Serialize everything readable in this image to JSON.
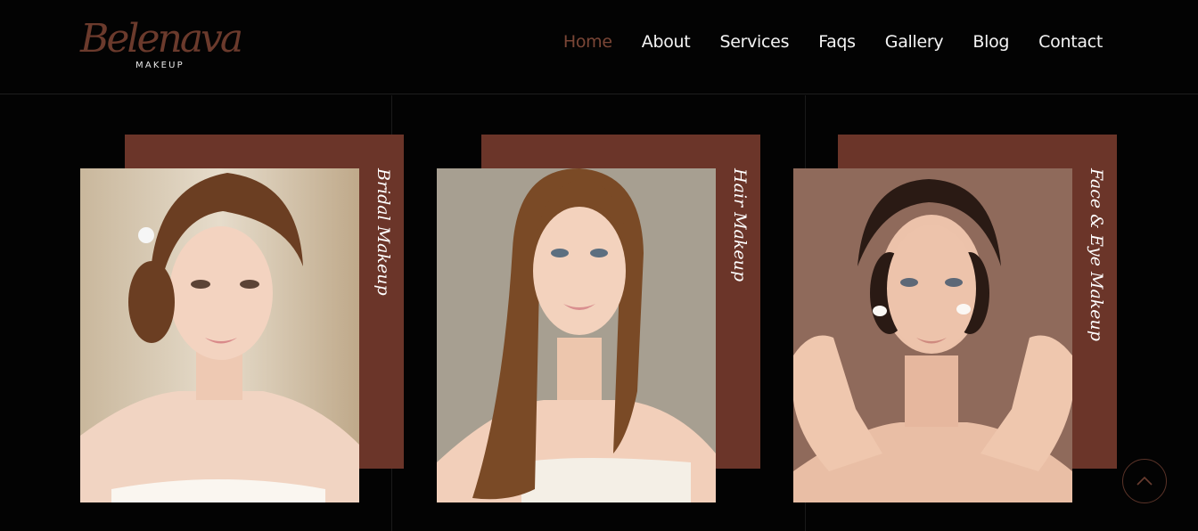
{
  "brand": {
    "script": "Belenava",
    "sub": "MAKEUP"
  },
  "nav": [
    {
      "label": "Home",
      "active": true
    },
    {
      "label": "About"
    },
    {
      "label": "Services"
    },
    {
      "label": "Faqs"
    },
    {
      "label": "Gallery"
    },
    {
      "label": "Blog"
    },
    {
      "label": "Contact"
    }
  ],
  "cards": [
    {
      "label": "Bridal Makeup"
    },
    {
      "label": "Hair Makeup"
    },
    {
      "label": "Face & Eye Makeup"
    }
  ],
  "colors": {
    "accent": "#6b3529",
    "active_nav": "#7a4636",
    "background": "#030303"
  },
  "icons": {
    "scroll_top": "chevron-up-icon"
  }
}
